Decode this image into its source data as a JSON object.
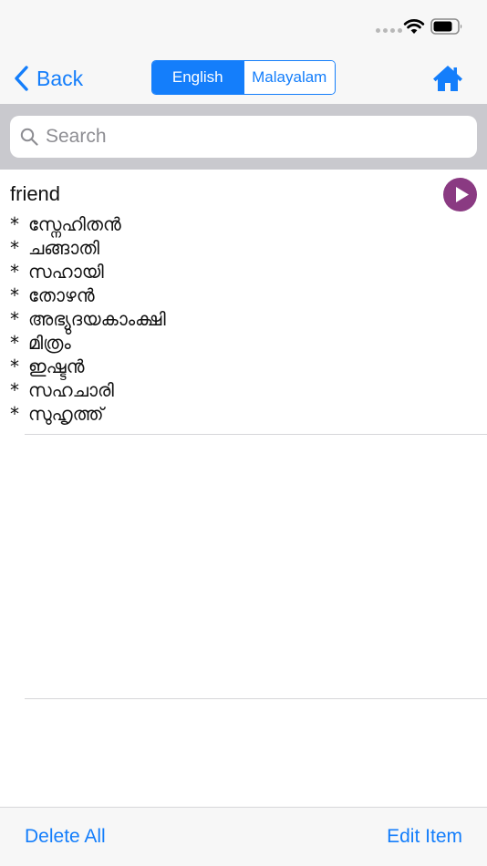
{
  "nav": {
    "back_label": "Back",
    "segments": [
      {
        "label": "English",
        "selected": true
      },
      {
        "label": "Malayalam",
        "selected": false
      }
    ]
  },
  "search": {
    "placeholder": "Search",
    "value": ""
  },
  "entry": {
    "word": "friend",
    "bullet": "*",
    "meanings": [
      "സ്നേഹിതൻ",
      "ചങ്ങാതി",
      "സഹായി",
      "തോഴൻ",
      "അഭ്യുദയകാംക്ഷി",
      "മിത്രം",
      "ഇഷ്ടൻ",
      "സഹചാരി",
      "സുഹൃത്ത്"
    ]
  },
  "toolbar": {
    "delete_all_label": "Delete All",
    "edit_item_label": "Edit Item"
  },
  "colors": {
    "accent": "#147efb",
    "play_button": "#8a3a82",
    "search_band": "#c9c9ce",
    "bar_background": "#f7f7f7"
  },
  "icons": [
    "signal-icon",
    "wifi-icon",
    "battery-icon",
    "back-chevron-icon",
    "home-icon",
    "search-icon",
    "play-icon"
  ]
}
